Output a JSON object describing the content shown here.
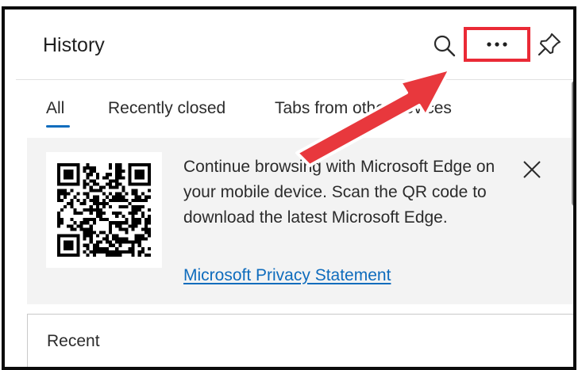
{
  "header": {
    "title": "History",
    "icons": {
      "search": "search-icon",
      "more": "more-options-icon",
      "pin": "pin-icon"
    }
  },
  "tabs": [
    {
      "label": "All",
      "selected": true
    },
    {
      "label": "Recently closed",
      "selected": false
    },
    {
      "label": "Tabs from other devices",
      "selected": false
    }
  ],
  "promo": {
    "text": "Continue browsing with Microsoft Edge on your mobile device. Scan the QR code to download the latest Microsoft Edge.",
    "link": "Microsoft Privacy Statement",
    "close_icon": "close-icon"
  },
  "section": {
    "label": "Recent"
  },
  "colors": {
    "accent": "#0f6cbd",
    "highlight": "#ea2a36",
    "annotation_arrow": "#e8383d",
    "promo_background": "#f3f3f3"
  }
}
